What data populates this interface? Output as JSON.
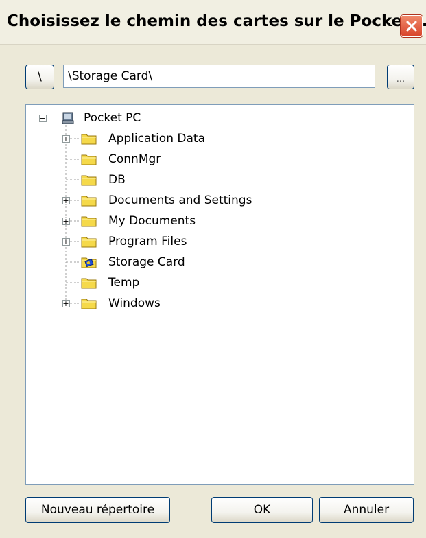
{
  "window": {
    "title": "Choisissez le chemin des cartes sur le Pocket..."
  },
  "pathbar": {
    "root_label": "\\",
    "path_value": "\\Storage Card\\",
    "browse_label": "..."
  },
  "tree": {
    "root": {
      "label": "Pocket PC",
      "expanded": true,
      "icon": "pocket-pc-icon"
    },
    "items": [
      {
        "label": "Application Data",
        "expandable": true,
        "icon": "folder-icon"
      },
      {
        "label": "ConnMgr",
        "expandable": false,
        "icon": "folder-icon"
      },
      {
        "label": "DB",
        "expandable": false,
        "icon": "folder-icon"
      },
      {
        "label": "Documents and Settings",
        "expandable": true,
        "icon": "folder-icon"
      },
      {
        "label": "My Documents",
        "expandable": true,
        "icon": "folder-icon"
      },
      {
        "label": "Program Files",
        "expandable": true,
        "icon": "folder-icon"
      },
      {
        "label": "Storage Card",
        "expandable": false,
        "icon": "storage-card-icon"
      },
      {
        "label": "Temp",
        "expandable": false,
        "icon": "folder-icon"
      },
      {
        "label": "Windows",
        "expandable": true,
        "icon": "folder-icon"
      }
    ]
  },
  "footer": {
    "new_dir_label": "Nouveau répertoire",
    "ok_label": "OK",
    "cancel_label": "Annuler"
  },
  "colors": {
    "window_bg": "#ece9d8",
    "folder_yellow": "#f5d94a",
    "close_red": "#d8432a"
  }
}
